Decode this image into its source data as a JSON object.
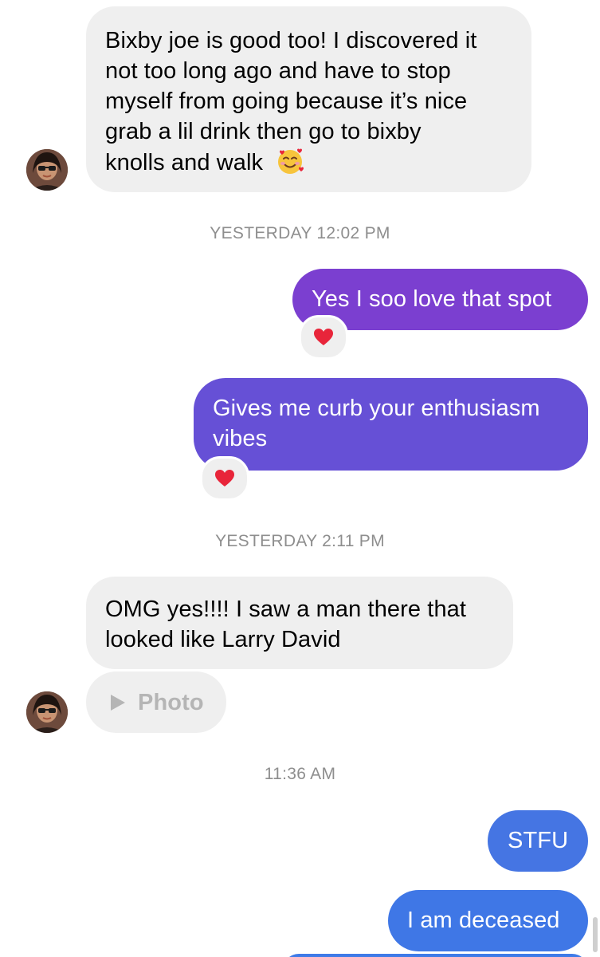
{
  "thread": {
    "messages": [
      {
        "type": "incoming",
        "text": "Bixby joe is good too! I discovered it not too long ago and have to stop myself from going because it’s nice grab a lil drink then go to bixby knolls and walk"
      },
      {
        "type": "timestamp",
        "text": "YESTERDAY 12:02 PM"
      },
      {
        "type": "outgoing",
        "text": "Yes I soo love that spot",
        "reaction": "heart"
      },
      {
        "type": "outgoing",
        "text": "Gives me curb your enthusiasm vibes",
        "reaction": "heart"
      },
      {
        "type": "timestamp",
        "text": "YESTERDAY 2:11 PM"
      },
      {
        "type": "incoming",
        "text": "OMG yes!!!! I saw a man there that looked like Larry David"
      },
      {
        "type": "incoming-media",
        "text": "Photo",
        "icon": "play-icon"
      },
      {
        "type": "timestamp",
        "text": "11:36 AM"
      },
      {
        "type": "outgoing",
        "text": "STFU"
      },
      {
        "type": "outgoing",
        "text": "I am deceased"
      }
    ],
    "msg1_line1": "Bixby joe is good too! I discovered it",
    "msg1_line2": "not too long ago and have to stop",
    "msg1_line3": "myself from going because it’s nice",
    "msg1_line4": "grab a lil drink then go to bixby",
    "msg1_line5": "knolls and walk",
    "msg4_line1": "Gives me curb your enthusiasm",
    "msg4_line2": "vibes",
    "msg6_line1": "OMG yes!!!! I saw a man there that",
    "msg6_line2": "looked like Larry David"
  },
  "emoji": {
    "smiling_hearts": "smiling-face-with-hearts",
    "reaction_heart": "red-heart"
  },
  "colors": {
    "incoming_bubble": "#efefef",
    "outgoing_purple": "#7b3fd0",
    "outgoing_indigo": "#6650d6",
    "outgoing_blue": "#3f77e6",
    "timestamp_text": "#8e8e8e",
    "heart": "#e8253a",
    "photo_text": "#b5b5b5"
  }
}
